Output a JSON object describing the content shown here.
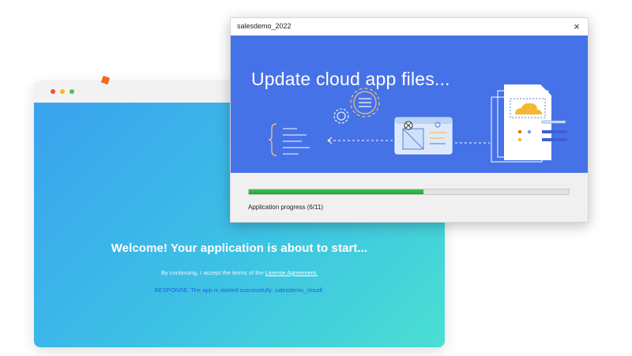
{
  "background_window": {
    "welcome_text": "Welcome! Your application is about to start...",
    "terms_prefix": "By continuing, I accept the terms of the",
    "terms_link": "License Agreement.",
    "response_text": "RESPONSE: The app is started successfully: salesdemo_cloud/."
  },
  "dialog": {
    "title": "salesdemo_2022",
    "close_icon": "×",
    "banner_title": "Update cloud app files...",
    "progress": {
      "label": "Application progress  (6/11)",
      "current": 6,
      "total": 11
    }
  },
  "colors": {
    "banner": "#4672e8",
    "progress_fill": "#2bb53c",
    "accent_orange": "#f26a21"
  }
}
